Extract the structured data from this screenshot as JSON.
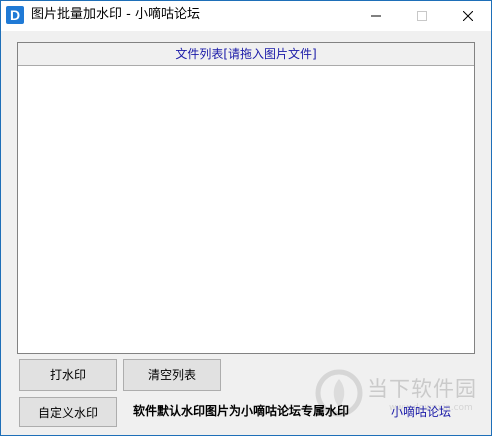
{
  "window": {
    "icon_letter": "D",
    "title": "图片批量加水印 - 小嘀咕论坛"
  },
  "file_list": {
    "header": "文件列表[请拖入图片文件]"
  },
  "buttons": {
    "add_watermark": "打水印",
    "clear_list": "清空列表",
    "custom_watermark": "自定义水印"
  },
  "notes": {
    "default_watermark": "软件默认水印图片为小嘀咕论坛专属水印"
  },
  "links": {
    "forum": "小嘀咕论坛"
  },
  "overlay_logo": {
    "name": "当下软件园",
    "domain": "www.downxia.com"
  },
  "colors": {
    "accent": "#1f7ad6",
    "link": "#1a1aa8"
  },
  "icons": {
    "minimize": "minimize-icon",
    "maximize": "maximize-icon",
    "close": "close-icon"
  }
}
